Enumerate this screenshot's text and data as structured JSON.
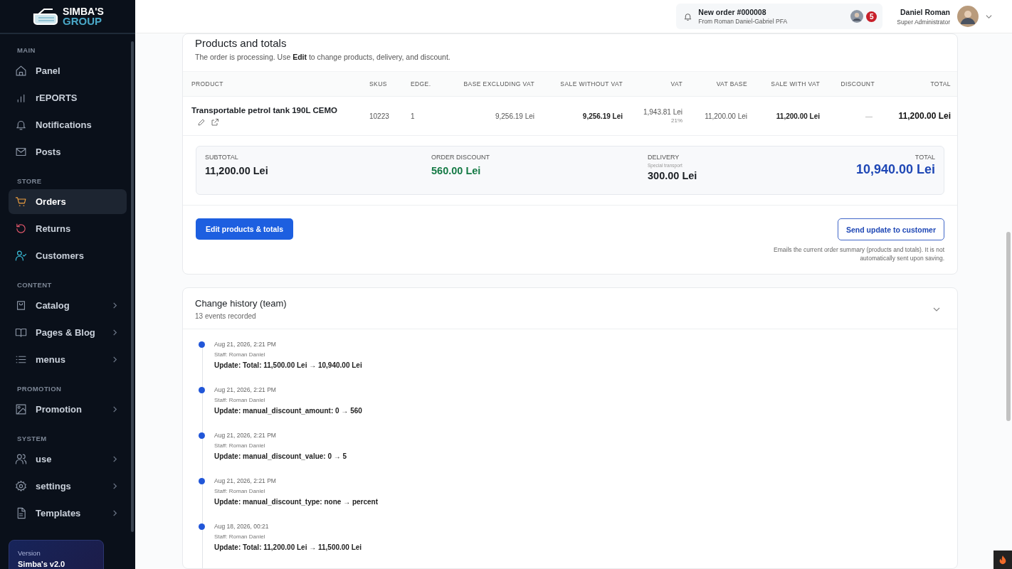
{
  "sidebar": {
    "logo": {
      "line_1": "SIMBA'S",
      "line_2": "GROUP"
    },
    "sections": [
      {
        "title": "MAIN",
        "items": [
          {
            "label": "Panel",
            "selected": false,
            "expandable": false
          },
          {
            "label": "rEPORTS",
            "selected": false,
            "expandable": false
          },
          {
            "label": "Notifications",
            "selected": false,
            "expandable": false
          },
          {
            "label": "Posts",
            "selected": false,
            "expandable": false
          }
        ]
      },
      {
        "title": "STORE",
        "items": [
          {
            "label": "Orders",
            "selected": true,
            "expandable": false
          },
          {
            "label": "Returns",
            "selected": false,
            "expandable": false
          },
          {
            "label": "Customers",
            "selected": false,
            "expandable": false
          }
        ]
      },
      {
        "title": "CONTENT",
        "items": [
          {
            "label": "Catalog",
            "selected": false,
            "expandable": true
          },
          {
            "label": "Pages & Blog",
            "selected": false,
            "expandable": true
          },
          {
            "label": "menus",
            "selected": false,
            "expandable": true
          }
        ]
      },
      {
        "title": "PROMOTION",
        "items": [
          {
            "label": "Promotion",
            "selected": false,
            "expandable": true
          }
        ]
      },
      {
        "title": "SYSTEM",
        "items": [
          {
            "label": "use",
            "selected": false,
            "expandable": true
          },
          {
            "label": "settings",
            "selected": false,
            "expandable": true
          },
          {
            "label": "Templates",
            "selected": false,
            "expandable": true
          }
        ]
      }
    ],
    "version": {
      "label": "Version",
      "value": "Simba's v2.0"
    }
  },
  "header": {
    "notification": {
      "title": "New order #000008",
      "subtitle": "From Roman Daniel-Gabriel PFA"
    },
    "badge": "5",
    "user": {
      "name": "Daniel Roman",
      "role": "Super Administrator"
    }
  },
  "products_card": {
    "title": "Products and totals",
    "description": "The order is processing. Use **Edit** to change products, delivery, and discount.",
    "table": {
      "columns": [
        "PRODUCT",
        "SKUS",
        "EDGE.",
        "BASE EXCLUDING VAT",
        "SALE WITHOUT VAT",
        "VAT",
        "VAT BASE",
        "SALE WITH VAT",
        "DISCOUNT",
        "TOTAL"
      ],
      "rows": [
        {
          "product": "Transportable petrol tank 190L CEMO",
          "sku": "10223",
          "qty": "1",
          "base": "9,256.19 Lei",
          "sale_no_vat": "9,256.19 Lei",
          "vat": "1,943.81 Lei",
          "vat_rate": "21%",
          "vat_base": "11,200.00 Lei",
          "sale_with_vat": "11,200.00 Lei",
          "discount": "—",
          "total": "11,200.00 Lei"
        }
      ]
    },
    "summary": {
      "subtotal": {
        "label": "SUBTOTAL",
        "value": "11,200.00 Lei"
      },
      "discount": {
        "label": "ORDER DISCOUNT",
        "value": "560.00 Lei"
      },
      "delivery": {
        "label": "DELIVERY",
        "note": "Special transport",
        "value": "300.00 Lei"
      },
      "total": {
        "label": "TOTAL",
        "value": "10,940.00 Lei"
      }
    },
    "edit_button": "Edit products & totals",
    "send_button": "Send update to customer",
    "send_note": "Emails the current order summary (products and totals). It is not automatically sent upon saving."
  },
  "history": {
    "title": "Change history (team)",
    "subtitle": "13 events recorded",
    "expanded": true,
    "events": [
      {
        "date": "Aug 21, 2026, 2:21 PM",
        "staff": "Staff: Roman Daniel",
        "change": "Update: Total: 11,500.00 Lei → 10,940.00 Lei"
      },
      {
        "date": "Aug 21, 2026, 2:21 PM",
        "staff": "Staff: Roman Daniel",
        "change": "Update: manual_discount_amount: 0 → 560"
      },
      {
        "date": "Aug 21, 2026, 2:21 PM",
        "staff": "Staff: Roman Daniel",
        "change": "Update: manual_discount_value: 0 → 5"
      },
      {
        "date": "Aug 21, 2026, 2:21 PM",
        "staff": "Staff: Roman Daniel",
        "change": "Update: manual_discount_type: none → percent"
      },
      {
        "date": "Aug 18, 2026, 00:21",
        "staff": "Staff: Roman Daniel",
        "change": "Update: Total: 11,200.00 Lei → 11,500.00 Lei"
      }
    ]
  }
}
